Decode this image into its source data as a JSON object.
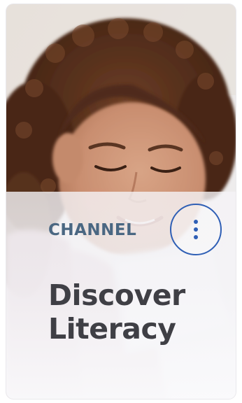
{
  "card": {
    "eyebrow": "CHANNEL",
    "title_line_1": "Discover",
    "title_line_2": "Literacy",
    "menu_icon": "more-vertical-icon",
    "photo_subject": "child-reading-photo"
  },
  "colors": {
    "eyebrow": "#4a6782",
    "title": "#3f3f45",
    "accent": "#2f5fb5",
    "card_bg": "#f3f2f4"
  }
}
